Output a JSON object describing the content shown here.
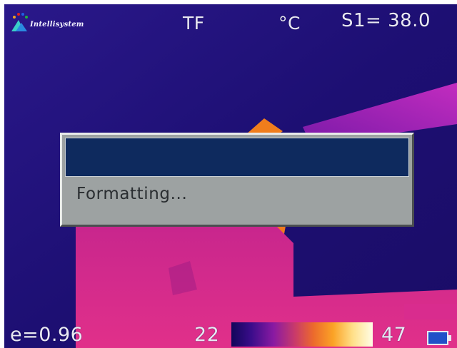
{
  "header": {
    "brand": "Intellisystem",
    "storage": "TF",
    "unit": "°C",
    "spot": "S1= 38.0"
  },
  "dialog": {
    "title": "",
    "message": "Formatting..."
  },
  "footer": {
    "emissivity": "e=0.96",
    "range_min": "22",
    "range_max": "47"
  },
  "colors": {
    "background": "#1d0f6e",
    "dialog_bar": "#0e2a5e",
    "dialog_body": "#9da2a2",
    "hot": "#e0308a"
  },
  "icons": {
    "logo": "logo-icon",
    "battery": "battery-icon"
  }
}
